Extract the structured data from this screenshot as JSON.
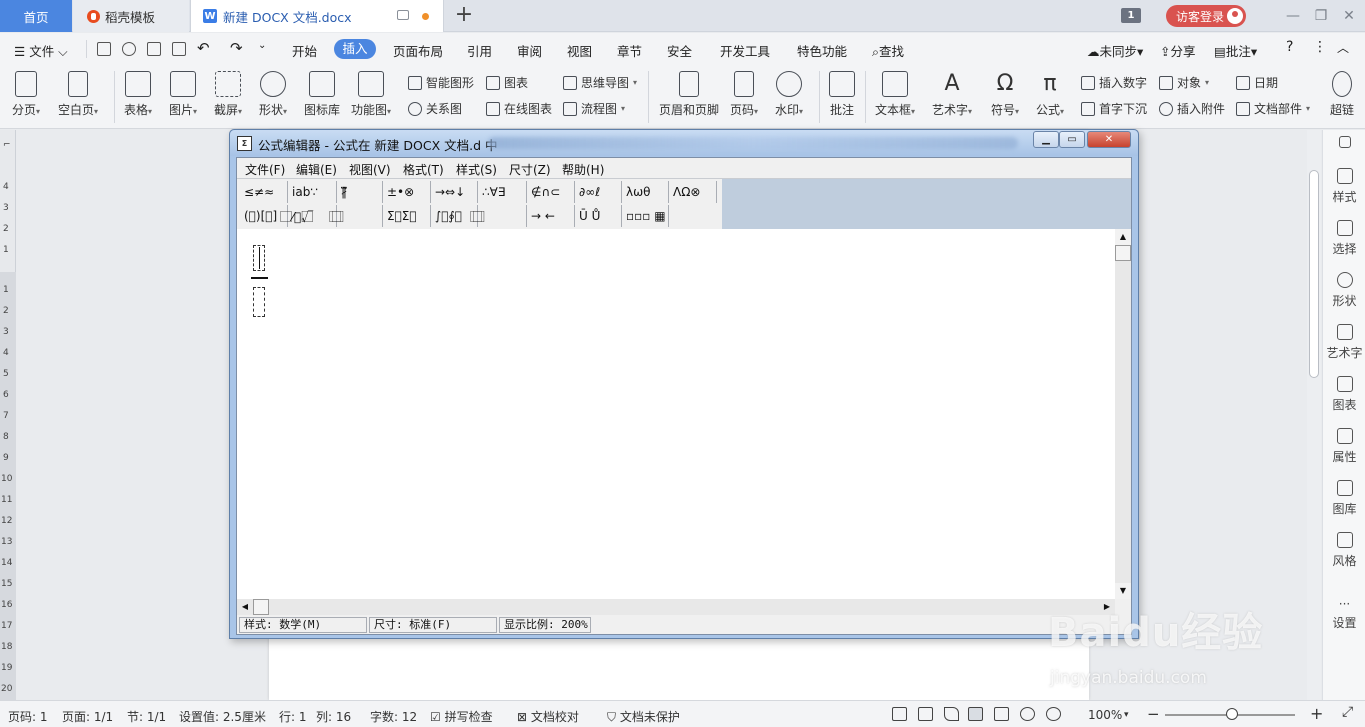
{
  "tabs": {
    "home": "首页",
    "template": "稻壳模板",
    "doc": "新建 DOCX 文档.docx",
    "window_count": "1",
    "login": "访客登录"
  },
  "menu": {
    "file": "文件",
    "items": [
      "开始",
      "插入",
      "页面布局",
      "引用",
      "审阅",
      "视图",
      "章节",
      "安全",
      "开发工具",
      "特色功能"
    ],
    "active": "插入",
    "search": "查找",
    "sync": "未同步",
    "share": "分享",
    "comment": "批注",
    "help": "?"
  },
  "ribbon": {
    "page_break": "分页",
    "blank_page": "空白页",
    "table": "表格",
    "picture": "图片",
    "screenshot": "截屏",
    "shape": "形状",
    "icon_lib": "图标库",
    "func_chart": "功能图",
    "smart_art": "智能图形",
    "relation": "关系图",
    "chart": "图表",
    "online_chart": "在线图表",
    "mind_map": "思维导图",
    "flow_chart": "流程图",
    "header_footer": "页眉和页脚",
    "page_num": "页码",
    "watermark": "水印",
    "annotation": "批注",
    "textbox": "文本框",
    "wordart": "艺术字",
    "symbol": "符号",
    "formula": "公式",
    "insert_number": "插入数字",
    "object": "对象",
    "date": "日期",
    "drop_cap": "首字下沉",
    "attachment": "插入附件",
    "doc_parts": "文档部件",
    "super": "超链"
  },
  "ruler": [
    "4",
    "3",
    "2",
    "1",
    "1",
    "2",
    "3",
    "4",
    "5",
    "6",
    "7",
    "8",
    "9",
    "10",
    "11",
    "12",
    "13",
    "14",
    "15",
    "16",
    "17",
    "18",
    "19",
    "20"
  ],
  "sidebar": [
    "样式",
    "选择",
    "形状",
    "艺术字",
    "图表",
    "属性",
    "图库",
    "风格",
    "设置"
  ],
  "eq_window": {
    "title": "公式编辑器 - 公式在 新建 DOCX 文档.d 中",
    "menus": [
      "文件(F)",
      "编辑(E)",
      "视图(V)",
      "格式(T)",
      "样式(S)",
      "尺寸(Z)",
      "帮助(H)"
    ],
    "toolbar_row1": [
      "≤≠≈",
      "ⅰab∵",
      "∦⃗⃛",
      "±•⊗",
      "→⇔↓",
      "∴∀∃",
      "∉∩⊂",
      "∂∞ℓ",
      "λωθ",
      "ΛΩ⊗"
    ],
    "toolbar_row2": [
      "(⃞)[⃞]",
      "⃞⁄⃞√⃞",
      "⃞ ⃞",
      "Σ⃞Σ⃞",
      "∫⃞∮⃞",
      "⃞ ⃞",
      "→ ←",
      "Ū Ů",
      "▫▫▫ ▦"
    ],
    "status_style": "样式: 数学(M)",
    "status_size": "尺寸: 标准(F)",
    "status_zoom": "显示比例: 200%"
  },
  "statusbar": {
    "page_num": "页码: 1",
    "pages": "页面: 1/1",
    "section": "节: 1/1",
    "setting": "设置值: 2.5厘米",
    "row": "行: 1",
    "col": "列: 16",
    "words": "字数: 12",
    "spell": "拼写检查",
    "proof": "文档校对",
    "protect": "文档未保护",
    "zoom": "100%"
  },
  "watermark": {
    "brand": "Baidu经验",
    "url": "jingyan.baidu.com"
  }
}
